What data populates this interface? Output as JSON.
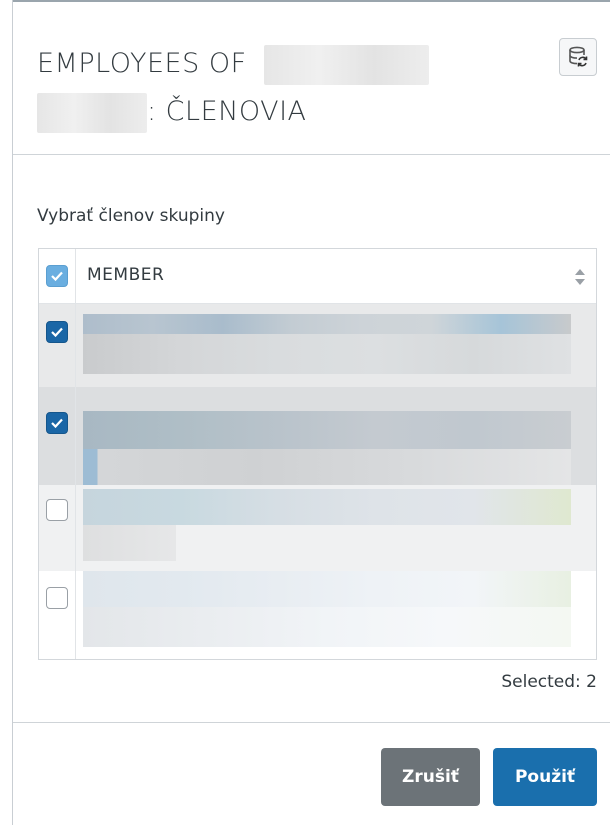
{
  "dialog": {
    "title_prefix": "EMPLOYEES OF",
    "title_suffix": ": ČLENOVIA",
    "refresh_icon": "refresh-database-icon"
  },
  "subtitle": "Vybrať členov skupiny",
  "table": {
    "header_label": "MEMBER",
    "select_all_state": "partial",
    "sort_icon": "sort-icon",
    "rows": [
      {
        "checked": true
      },
      {
        "checked": true
      },
      {
        "checked": false
      },
      {
        "checked": false
      }
    ]
  },
  "selected_text": "Selected: 2",
  "buttons": {
    "cancel_label": "Zrušiť",
    "apply_label": "Použiť"
  }
}
